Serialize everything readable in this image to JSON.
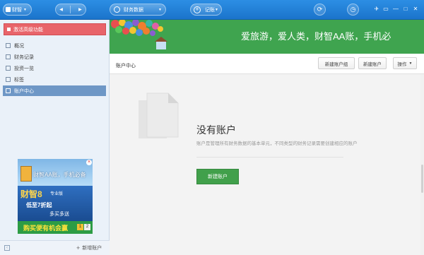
{
  "titlebar": {
    "app_menu_label": "财智",
    "nav_back_icon": "chevron-left-icon",
    "nav_forward_icon": "chevron-right-icon",
    "ledger_label": "财务数据",
    "record_label": "记账",
    "sync_icon": "sync-icon",
    "time_icon": "clock-icon",
    "window_icons": [
      "bird-icon",
      "skin-icon",
      "minimize-icon",
      "maximize-icon",
      "close-icon"
    ]
  },
  "sidebar": {
    "activate_label": "激活高级功能",
    "items": [
      {
        "label": "概况",
        "icon": "overview-icon"
      },
      {
        "label": "财务记录",
        "icon": "records-icon"
      },
      {
        "label": "投资一览",
        "icon": "invest-icon"
      },
      {
        "label": "标签",
        "icon": "tag-icon"
      },
      {
        "label": "账户中心",
        "icon": "account-icon",
        "active": true
      }
    ],
    "ad": {
      "slogan": "财智AA账，手机必备",
      "brand": "财智8",
      "brand_sub": "专业版",
      "line1": "低至7折起",
      "line2": "多买多送",
      "cta": "购买便有机会赢",
      "pages": [
        "1",
        "2"
      ]
    },
    "footer": {
      "add_ledger_label": "新增账户"
    }
  },
  "main": {
    "banner_text": "爱旅游，爱人类，财智AA账，手机必",
    "page_title": "账户中心",
    "buttons": {
      "new_group": "新建账户组",
      "new_account": "新建账户",
      "operations": "操作"
    },
    "empty": {
      "title": "没有账户",
      "description": "账户是管理所有财务数据的基本单元，不同类型的财务记录需要创建相应的账户",
      "create_button": "新建账户"
    }
  },
  "colors": {
    "titlebar": "#1f7ed7",
    "sidebar_bg": "#eaf1f9",
    "activate_red": "#e8646a",
    "active_item": "#6e97c6",
    "banner_green": "#3fa44f",
    "create_green": "#41a04b"
  }
}
